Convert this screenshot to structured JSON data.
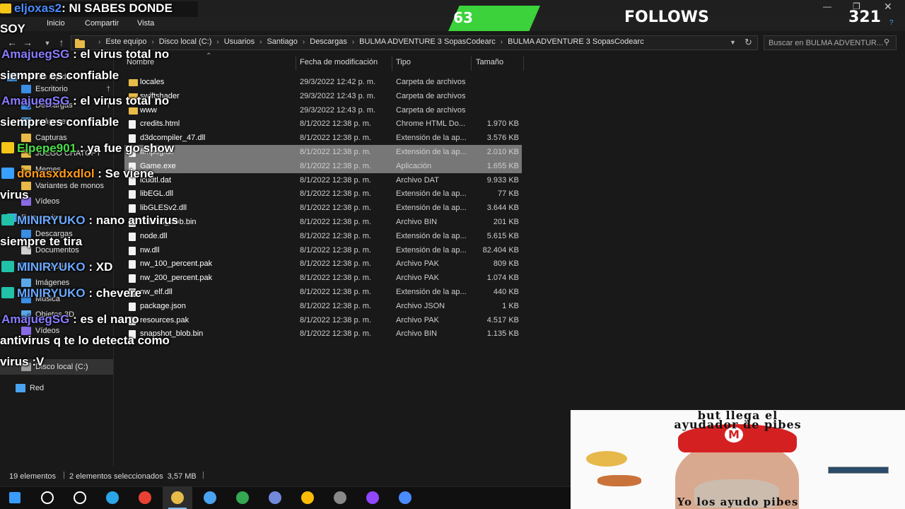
{
  "ribbon": {
    "tabs": [
      "Inicio",
      "Compartir",
      "Vista"
    ]
  },
  "address": {
    "crumbs": [
      "Este equipo",
      "Disco local (C:)",
      "Usuarios",
      "Santiago",
      "Descargas",
      "BULMA ADVENTURE 3 SopasCodearc",
      "BULMA ADVENTURE 3 SopasCodearc"
    ],
    "search_placeholder": "Buscar en BULMA ADVENTUR..."
  },
  "columns": {
    "name": "Nombre",
    "date": "Fecha de modificación",
    "type": "Tipo",
    "size": "Tamaño"
  },
  "sidebar": {
    "items": [
      {
        "label": "Acceso rápido",
        "icon": "star-icon",
        "color": "#4aa3f0"
      },
      {
        "label": "Escritorio",
        "icon": "desktop-icon",
        "color": "#3a8ee6"
      },
      {
        "label": "Descargas",
        "icon": "download-icon",
        "color": "#3a8ee6"
      },
      {
        "label": "Imágenes",
        "icon": "pictures-icon",
        "color": "#5aa8e8"
      },
      {
        "label": "Capturas",
        "icon": "folder-icon",
        "color": "#e8bb48"
      },
      {
        "label": "JUEGO CHATGPT",
        "icon": "folder-icon",
        "color": "#e8bb48"
      },
      {
        "label": "Memes",
        "icon": "folder-icon",
        "color": "#e8bb48"
      },
      {
        "label": "Variantes de monos",
        "icon": "folder-icon",
        "color": "#e8bb48"
      },
      {
        "label": "Vídeos",
        "icon": "videos-icon",
        "color": "#8a6be6"
      },
      {
        "label": "Este equipo",
        "icon": "computer-icon",
        "color": "#4aa3f0"
      },
      {
        "label": "Descargas",
        "icon": "download-icon",
        "color": "#3a8ee6"
      },
      {
        "label": "Documentos",
        "icon": "documents-icon",
        "color": "#cfcfcf"
      },
      {
        "label": "Escritorio",
        "icon": "desktop-icon",
        "color": "#3a8ee6"
      },
      {
        "label": "Imágenes",
        "icon": "pictures-icon",
        "color": "#5aa8e8"
      },
      {
        "label": "Música",
        "icon": "music-icon",
        "color": "#3a8ee6"
      },
      {
        "label": "Objetos 3D",
        "icon": "objects3d-icon",
        "color": "#5aa8e8"
      },
      {
        "label": "Vídeos",
        "icon": "videos-icon",
        "color": "#8a6be6"
      },
      {
        "label": "Disco local (C:)",
        "icon": "drive-icon",
        "color": "#9a9a9a"
      },
      {
        "label": "Red",
        "icon": "network-icon",
        "color": "#4aa3f0"
      }
    ]
  },
  "files": [
    {
      "name": "locales",
      "date": "29/3/2022 12:42 p. m.",
      "type": "Carpeta de archivos",
      "size": "",
      "icon": "folder-icon"
    },
    {
      "name": "swiftshader",
      "date": "29/3/2022 12:43 p. m.",
      "type": "Carpeta de archivos",
      "size": "",
      "icon": "folder-icon"
    },
    {
      "name": "www",
      "date": "29/3/2022 12:43 p. m.",
      "type": "Carpeta de archivos",
      "size": "",
      "icon": "folder-icon"
    },
    {
      "name": "credits.html",
      "date": "8/1/2022 12:38 p. m.",
      "type": "Chrome HTML Do...",
      "size": "1.970 KB",
      "icon": "html-file-icon"
    },
    {
      "name": "d3dcompiler_47.dll",
      "date": "8/1/2022 12:38 p. m.",
      "type": "Extensión de la ap...",
      "size": "3.576 KB",
      "icon": "dll-file-icon"
    },
    {
      "name": "ffmpeg.dll",
      "date": "8/1/2022 12:38 p. m.",
      "type": "Extensión de la ap...",
      "size": "2.010 KB",
      "icon": "dll-file-icon"
    },
    {
      "name": "Game.exe",
      "date": "8/1/2022 12:38 p. m.",
      "type": "Aplicación",
      "size": "1.655 KB",
      "icon": "exe-file-icon"
    },
    {
      "name": "icudtl.dat",
      "date": "8/1/2022 12:38 p. m.",
      "type": "Archivo DAT",
      "size": "9.933 KB",
      "icon": "file-icon"
    },
    {
      "name": "libEGL.dll",
      "date": "8/1/2022 12:38 p. m.",
      "type": "Extensión de la ap...",
      "size": "77 KB",
      "icon": "dll-file-icon"
    },
    {
      "name": "libGLESv2.dll",
      "date": "8/1/2022 12:38 p. m.",
      "type": "Extensión de la ap...",
      "size": "3.644 KB",
      "icon": "dll-file-icon"
    },
    {
      "name": "natives_blob.bin",
      "date": "8/1/2022 12:38 p. m.",
      "type": "Archivo BIN",
      "size": "201 KB",
      "icon": "file-icon"
    },
    {
      "name": "node.dll",
      "date": "8/1/2022 12:38 p. m.",
      "type": "Extensión de la ap...",
      "size": "5.615 KB",
      "icon": "dll-file-icon"
    },
    {
      "name": "nw.dll",
      "date": "8/1/2022 12:38 p. m.",
      "type": "Extensión de la ap...",
      "size": "82.404 KB",
      "icon": "dll-file-icon"
    },
    {
      "name": "nw_100_percent.pak",
      "date": "8/1/2022 12:38 p. m.",
      "type": "Archivo PAK",
      "size": "809 KB",
      "icon": "file-icon"
    },
    {
      "name": "nw_200_percent.pak",
      "date": "8/1/2022 12:38 p. m.",
      "type": "Archivo PAK",
      "size": "1.074 KB",
      "icon": "file-icon"
    },
    {
      "name": "nw_elf.dll",
      "date": "8/1/2022 12:38 p. m.",
      "type": "Extensión de la ap...",
      "size": "440 KB",
      "icon": "dll-file-icon"
    },
    {
      "name": "package.json",
      "date": "8/1/2022 12:38 p. m.",
      "type": "Archivo JSON",
      "size": "1 KB",
      "icon": "file-icon"
    },
    {
      "name": "resources.pak",
      "date": "8/1/2022 12:38 p. m.",
      "type": "Archivo PAK",
      "size": "4.517 KB",
      "icon": "file-icon"
    },
    {
      "name": "snapshot_blob.bin",
      "date": "8/1/2022 12:38 p. m.",
      "type": "Archivo BIN",
      "size": "1.135 KB",
      "icon": "file-icon"
    }
  ],
  "status": {
    "count": "19 elementos",
    "selection": "2 elementos seleccionados  3,57 MB"
  },
  "overlay": {
    "alert_user": "eljoxas2",
    "alert_text": ": NI SABES DONDE",
    "alert_cont": "SOY",
    "goal_number": "63",
    "follows_label": "FOLLOWS",
    "follows_count": "321",
    "chat": [
      {
        "user": "AmajuegSG",
        "color": "#8a7cff",
        "text": " : el virus total no",
        "cont": "siempre es confiable",
        "badge": ""
      },
      {
        "user": "AmajuegSG",
        "color": "#8a7cff",
        "text": " : el virus total no",
        "cont": "siempre es confiable",
        "badge": ""
      },
      {
        "user": "Elpepe901",
        "color": "#4adf4a",
        "text": " : ya fue go show",
        "cont": "",
        "badge": "#f5c518"
      },
      {
        "user": "donasxdxdlol",
        "color": "#ff9a1a",
        "text": " : Se viene",
        "cont": "virus",
        "badge": "#3aa0ff"
      },
      {
        "user": "MINIRYUKO",
        "color": "#6aa8ff",
        "text": " : nano antivirus",
        "cont": "siempre te tira",
        "badge": "#21c2a8"
      },
      {
        "user": "MINIRYUKO",
        "color": "#6aa8ff",
        "text": " : XD",
        "cont": "",
        "badge": "#21c2a8"
      },
      {
        "user": "MINIRYUKO",
        "color": "#6aa8ff",
        "text": " : chevere",
        "cont": "",
        "badge": "#21c2a8"
      },
      {
        "user": "AmajuegSG",
        "color": "#8a7cff",
        "text": " : es el nano",
        "cont": "antivirus q te lo detecta como",
        "cont2": "virus :V",
        "badge": ""
      }
    ]
  },
  "meme": {
    "top_line1": "but llega el",
    "top_line2": "ayudador de pibes",
    "bottom": "Yo los ayudo pibes"
  },
  "taskbar": {
    "apps": [
      {
        "icon": "windows-start-icon",
        "color": "#3a9bff"
      },
      {
        "icon": "search-icon",
        "color": "#ffffff"
      },
      {
        "icon": "task-view-icon",
        "color": "#ffffff"
      },
      {
        "icon": "edge-icon",
        "color": "#2aa6e8"
      },
      {
        "icon": "chrome-icon",
        "color": "#e94235"
      },
      {
        "icon": "file-explorer-icon",
        "color": "#e8bb48"
      },
      {
        "icon": "app-icon",
        "color": "#4aa3f0"
      },
      {
        "icon": "chrome-icon",
        "color": "#34a853"
      },
      {
        "icon": "discord-icon",
        "color": "#7289da"
      },
      {
        "icon": "chrome-icon",
        "color": "#fbbc05"
      },
      {
        "icon": "obs-icon",
        "color": "#888888"
      },
      {
        "icon": "twitch-icon",
        "color": "#9146ff"
      },
      {
        "icon": "app-icon",
        "color": "#4a8cff"
      }
    ]
  }
}
